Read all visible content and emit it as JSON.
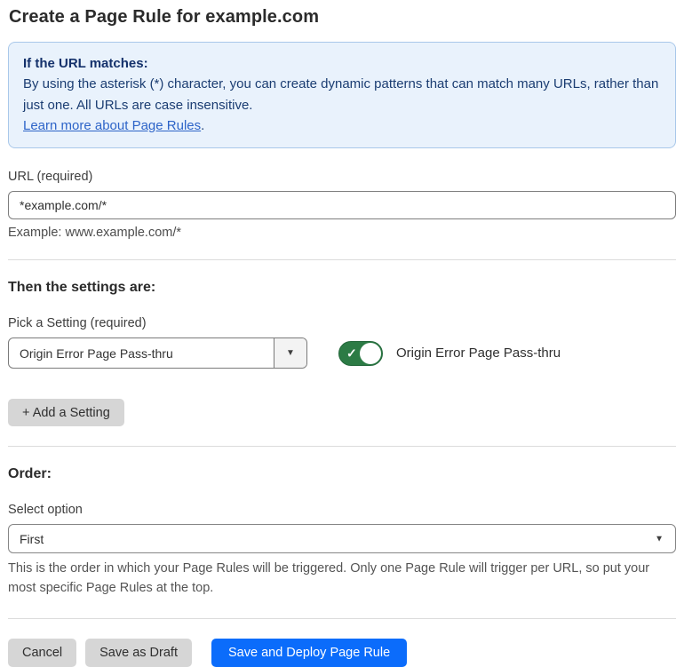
{
  "page": {
    "title": "Create a Page Rule for example.com"
  },
  "info_box": {
    "heading": "If the URL matches:",
    "body": "By using the asterisk (*) character, you can create dynamic patterns that can match many URLs, rather than just one. All URLs are case insensitive.",
    "link_label": "Learn more about Page Rules",
    "link_suffix": "."
  },
  "url_field": {
    "label": "URL (required)",
    "value": "*example.com/*",
    "helper": "Example: www.example.com/*"
  },
  "settings_section": {
    "heading": "Then the settings are:",
    "picker_label": "Pick a Setting (required)",
    "picker_value": "Origin Error Page Pass-thru",
    "toggle_state": "on",
    "toggle_label": "Origin Error Page Pass-thru",
    "add_setting_label": "+ Add a Setting"
  },
  "order_section": {
    "heading": "Order:",
    "select_label": "Select option",
    "select_value": "First",
    "helper": "This is the order in which your Page Rules will be triggered. Only one Page Rule will trigger per URL, so put your most specific Page Rules at the top."
  },
  "footer": {
    "cancel_label": "Cancel",
    "save_draft_label": "Save as Draft",
    "save_deploy_label": "Save and Deploy Page Rule"
  },
  "icons": {
    "check": "✓",
    "caret_down": "▼"
  },
  "colors": {
    "primary_blue": "#0b6cfb",
    "toggle_green": "#2c7b45",
    "info_background": "#e9f2fc",
    "info_border": "#a9c8ea",
    "info_text": "#16386b",
    "link_blue": "#2d64c8"
  }
}
